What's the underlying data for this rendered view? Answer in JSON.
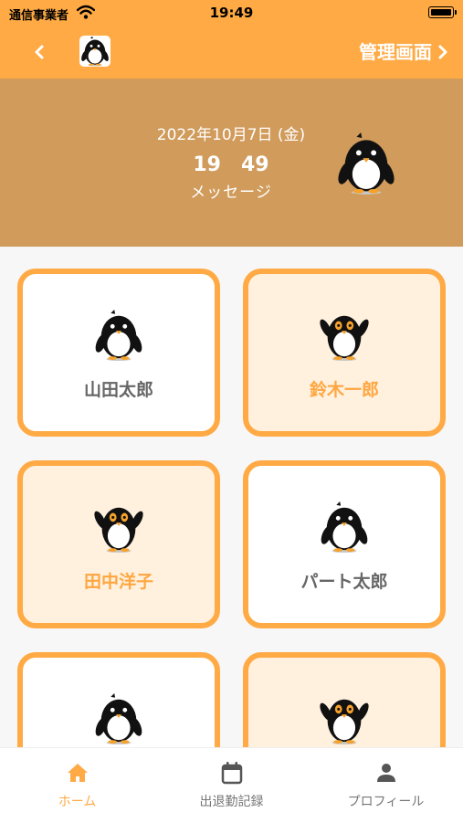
{
  "status_bar": {
    "carrier": "通信事業者",
    "time": "19:49"
  },
  "nav": {
    "admin_label": "管理画面"
  },
  "header": {
    "date": "2022年10月7日 (金)",
    "time": "19　49",
    "message": "メッセージ"
  },
  "staff": [
    {
      "name": "山田太郎",
      "style": "white",
      "pose": "standing"
    },
    {
      "name": "鈴木一郎",
      "style": "peach",
      "pose": "waving"
    },
    {
      "name": "田中洋子",
      "style": "peach",
      "pose": "waving"
    },
    {
      "name": "パート太郎",
      "style": "white",
      "pose": "standing"
    },
    {
      "name": "",
      "style": "white",
      "pose": "standing"
    },
    {
      "name": "",
      "style": "peach",
      "pose": "waving"
    }
  ],
  "tabs": [
    {
      "label": "ホーム",
      "icon": "home-icon",
      "active": true
    },
    {
      "label": "出退勤記録",
      "icon": "calendar-icon",
      "active": false
    },
    {
      "label": "プロフィール",
      "icon": "person-icon",
      "active": false
    }
  ],
  "colors": {
    "accent": "#ffaa44",
    "header_band": "#d09b5b",
    "card_peach": "#fff1de"
  }
}
